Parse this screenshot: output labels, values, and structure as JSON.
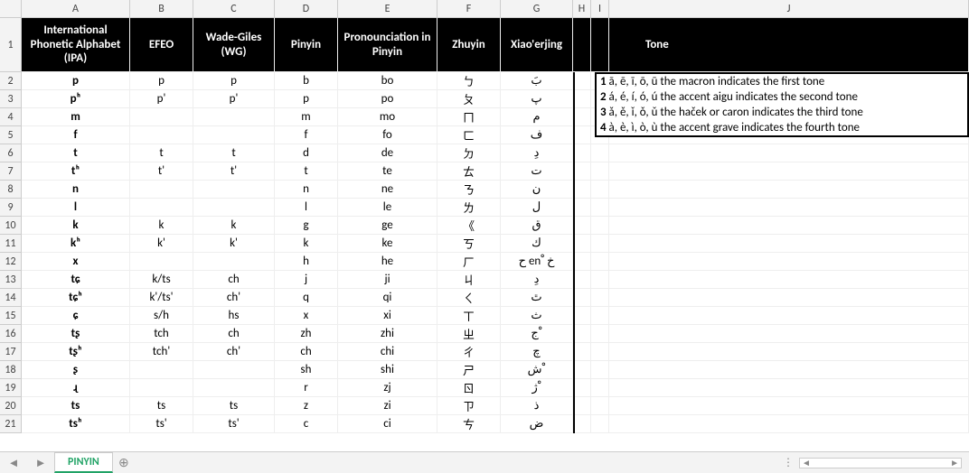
{
  "columns": [
    "A",
    "B",
    "C",
    "D",
    "E",
    "F",
    "G",
    "H",
    "I",
    "J"
  ],
  "row_numbers": [
    1,
    2,
    3,
    4,
    5,
    6,
    7,
    8,
    9,
    10,
    11,
    12,
    13,
    14,
    15,
    16,
    17,
    18,
    19,
    20,
    21
  ],
  "headers": {
    "A": "International Phonetic Alphabet (IPA)",
    "B": "EFEO",
    "C": "Wade-Giles (WG)",
    "D": "Pinyin",
    "E": "Pronounciation in Pinyin",
    "F": "Zhuyin",
    "G": "Xiao'erjing",
    "J": "Tone"
  },
  "rows": [
    {
      "A": "p",
      "B": "p",
      "C": "p",
      "D": "b",
      "E": "bo",
      "F": "ㄅ",
      "G": "بَ"
    },
    {
      "A": "pʰ",
      "B": "p'",
      "C": "p'",
      "D": "p",
      "E": "po",
      "F": "ㄆ",
      "G": "پ"
    },
    {
      "A": "m",
      "B": "",
      "C": "",
      "D": "m",
      "E": "mo",
      "F": "ㄇ",
      "G": "م"
    },
    {
      "A": "f",
      "B": "",
      "C": "",
      "D": "f",
      "E": "fo",
      "F": "ㄈ",
      "G": "ف"
    },
    {
      "A": "t",
      "B": "t",
      "C": "t",
      "D": "d",
      "E": "de",
      "F": "ㄉ",
      "G": "دِ"
    },
    {
      "A": "tʰ",
      "B": "t'",
      "C": "t'",
      "D": "t",
      "E": "te",
      "F": "ㄊ",
      "G": "ت"
    },
    {
      "A": "n",
      "B": "",
      "C": "",
      "D": "n",
      "E": "ne",
      "F": "ㄋ",
      "G": "ن"
    },
    {
      "A": "l",
      "B": "",
      "C": "",
      "D": "l",
      "E": "le",
      "F": "ㄌ",
      "G": "ل"
    },
    {
      "A": "k",
      "B": "k",
      "C": "k",
      "D": "g",
      "E": "ge",
      "F": "《",
      "G": "ق"
    },
    {
      "A": "kʰ",
      "B": "k'",
      "C": "k'",
      "D": "k",
      "E": "ke",
      "F": "ㄎ",
      "G": "ك"
    },
    {
      "A": "x",
      "B": "",
      "C": "",
      "D": "h",
      "E": "he",
      "F": "ㄏ",
      "G": "ح en ْ خ"
    },
    {
      "A": "tɕ",
      "B": "k/ts",
      "C": "ch",
      "D": "j",
      "E": "ji",
      "F": "ㄐ",
      "G": "دِ"
    },
    {
      "A": "tɕʰ",
      "B": "k'/ts'",
      "C": "ch'",
      "D": "q",
      "E": "qi",
      "F": "ㄑ",
      "G": "ٿ"
    },
    {
      "A": "ɕ",
      "B": "s/h",
      "C": "hs",
      "D": "x",
      "E": "xi",
      "F": "ㄒ",
      "G": "ث"
    },
    {
      "A": "tʂ",
      "B": "tch",
      "C": "ch",
      "D": "zh",
      "E": "zhi",
      "F": "ㄓ",
      "G": "ج ْ"
    },
    {
      "A": "tʂʰ",
      "B": "tch'",
      "C": "ch'",
      "D": "ch",
      "E": "chi",
      "F": "ㄔ",
      "G": "چ"
    },
    {
      "A": "ʂ",
      "B": "",
      "C": "",
      "D": "sh",
      "E": "shi",
      "F": "ㄕ",
      "G": "ش ْ"
    },
    {
      "A": "ɻ",
      "B": "",
      "C": "",
      "D": "r",
      "E": "zj",
      "F": "ㄖ",
      "G": "ژ ْ"
    },
    {
      "A": "ts",
      "B": "ts",
      "C": "ts",
      "D": "z",
      "E": "zi",
      "F": "ㄗ",
      "G": "ذ"
    },
    {
      "A": "tsʰ",
      "B": "ts'",
      "C": "ts'",
      "D": "c",
      "E": "ci",
      "F": "ㄘ",
      "G": "ض"
    }
  ],
  "tone_notes": [
    {
      "n": "1",
      "text": "ā, ē, ī, ō, ū the macron indicates the first tone"
    },
    {
      "n": "2",
      "text": "á, é, í, ó, ú the accent aigu indicates the second tone"
    },
    {
      "n": "3",
      "text": "ǎ, ě, ǐ, ǒ, ǔ the haček or caron indicates the third tone"
    },
    {
      "n": "4",
      "text": "à, è, ì, ò, ù the accent grave indicates the fourth tone"
    }
  ],
  "sheet_tab": "PINYIN"
}
